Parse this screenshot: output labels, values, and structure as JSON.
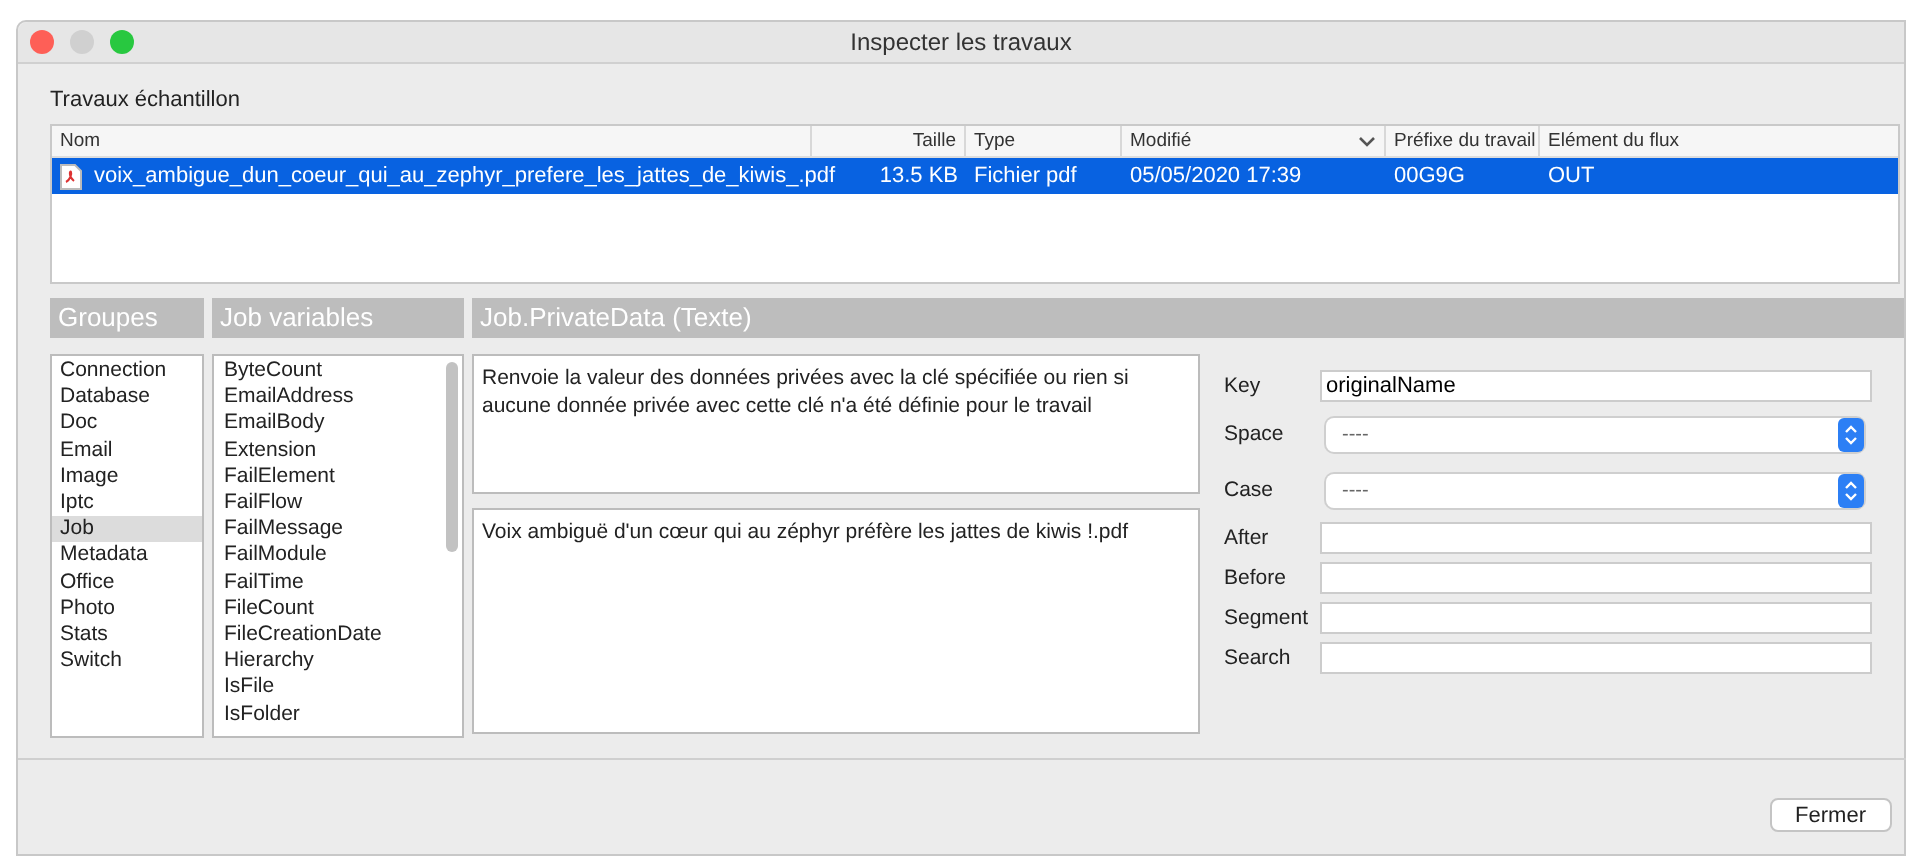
{
  "window": {
    "title": "Inspecter les travaux"
  },
  "section_title": "Travaux échantillon",
  "table": {
    "columns": [
      {
        "label": "Nom",
        "sorted": false
      },
      {
        "label": "Taille",
        "sorted": false
      },
      {
        "label": "Type",
        "sorted": false
      },
      {
        "label": "Modifié",
        "sorted": true
      },
      {
        "label": "Préfixe du travail",
        "sorted": false
      },
      {
        "label": "Elément du flux",
        "sorted": false
      }
    ],
    "rows": [
      {
        "selected": true,
        "cells": [
          "voix_ambigue_dun_coeur_qui_au_zephyr_prefere_les_jattes_de_kiwis_.pdf",
          "13.5 KB",
          "Fichier pdf",
          "05/05/2020 17:39",
          "00G9G",
          "OUT"
        ]
      }
    ]
  },
  "groups": {
    "title": "Groupes",
    "items": [
      {
        "label": "Connection",
        "selected": false
      },
      {
        "label": "Database",
        "selected": false
      },
      {
        "label": "Doc",
        "selected": false
      },
      {
        "label": "Email",
        "selected": false
      },
      {
        "label": "Image",
        "selected": false
      },
      {
        "label": "Iptc",
        "selected": false
      },
      {
        "label": "Job",
        "selected": true
      },
      {
        "label": "Metadata",
        "selected": false
      },
      {
        "label": "Office",
        "selected": false
      },
      {
        "label": "Photo",
        "selected": false
      },
      {
        "label": "Stats",
        "selected": false
      },
      {
        "label": "Switch",
        "selected": false
      }
    ]
  },
  "variables": {
    "title": "Job variables",
    "items": [
      {
        "label": "ByteCount",
        "selected": false
      },
      {
        "label": "EmailAddress",
        "selected": false
      },
      {
        "label": "EmailBody",
        "selected": false
      },
      {
        "label": "Extension",
        "selected": false
      },
      {
        "label": "FailElement",
        "selected": false
      },
      {
        "label": "FailFlow",
        "selected": false
      },
      {
        "label": "FailMessage",
        "selected": false
      },
      {
        "label": "FailModule",
        "selected": false
      },
      {
        "label": "FailTime",
        "selected": false
      },
      {
        "label": "FileCount",
        "selected": false
      },
      {
        "label": "FileCreationDate",
        "selected": false
      },
      {
        "label": "Hierarchy",
        "selected": false
      },
      {
        "label": "IsFile",
        "selected": false
      },
      {
        "label": "IsFolder",
        "selected": false
      }
    ]
  },
  "detail": {
    "title": "Job.PrivateData (Texte)",
    "description": "Renvoie la valeur des données privées avec la clé spécifiée ou rien si aucune donnée privée avec cette clé n'a été définie pour le travail",
    "result": "Voix ambiguë d'un cœur qui au zéphyr préfère les jattes de kiwis !.pdf"
  },
  "fields": [
    {
      "label": "Key",
      "kind": "text",
      "value": "originalName"
    },
    {
      "label": "Space",
      "kind": "select",
      "value": "----"
    },
    {
      "label": "Case",
      "kind": "select",
      "value": "----"
    },
    {
      "label": "After",
      "kind": "text"
    },
    {
      "label": "Before",
      "kind": "text"
    },
    {
      "label": "Segment",
      "kind": "text"
    },
    {
      "label": "Search",
      "kind": "text"
    }
  ],
  "buttons": [
    {
      "label": "Fermer"
    }
  ]
}
